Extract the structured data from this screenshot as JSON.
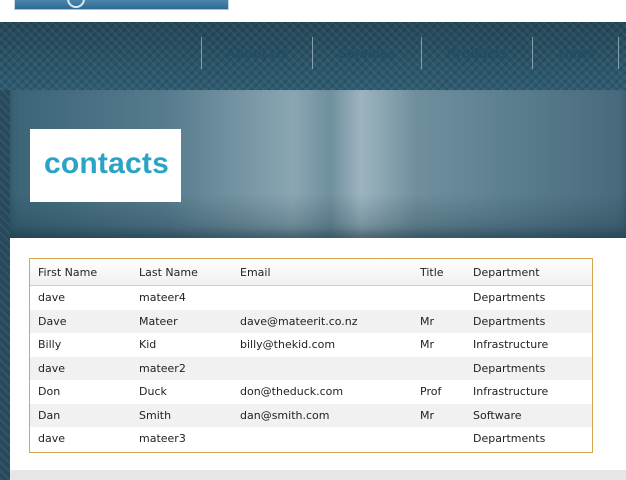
{
  "nav": {
    "items": [
      {
        "label": "About Us"
      },
      {
        "label": "Services"
      },
      {
        "label": "Products"
      },
      {
        "label": "News"
      }
    ]
  },
  "hero": {
    "title": "contacts"
  },
  "table": {
    "headers": [
      "First Name",
      "Last Name",
      "Email",
      "Title",
      "Department"
    ],
    "rows": [
      [
        "dave",
        "mateer4",
        "",
        "",
        "Departments"
      ],
      [
        "Dave",
        "Mateer",
        "dave@mateerit.co.nz",
        "Mr",
        "Departments"
      ],
      [
        "Billy",
        "Kid",
        "billy@thekid.com",
        "Mr",
        "Infrastructure"
      ],
      [
        "dave",
        "mateer2",
        "",
        "",
        "Departments"
      ],
      [
        "Don",
        "Duck",
        "don@theduck.com",
        "Prof",
        "Infrastructure"
      ],
      [
        "Dan",
        "Smith",
        "dan@smith.com",
        "Mr",
        "Software"
      ],
      [
        "dave",
        "mateer3",
        "",
        "",
        "Departments"
      ]
    ]
  },
  "colors": {
    "title_accent": "#2aa3c4",
    "grid_border": "#d8a651",
    "nav_text": "#1f4d63"
  }
}
